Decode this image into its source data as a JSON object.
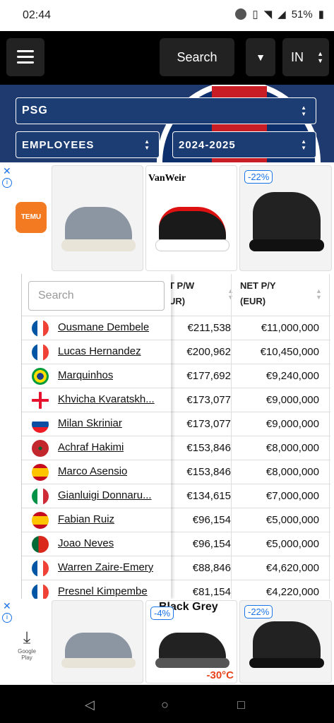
{
  "status_bar": {
    "time": "02:44",
    "battery": "51%"
  },
  "header": {
    "search_label": "Search",
    "country_label": "IN"
  },
  "filters": {
    "team": "PSG",
    "category": "EMPLOYEES",
    "season": "2024-2025"
  },
  "ads": {
    "top": {
      "brand": "TEMU",
      "items": [
        {
          "label": ""
        },
        {
          "label": "VanWeir"
        },
        {
          "label": "-22%"
        }
      ]
    },
    "bottom": {
      "store": "Google Play",
      "items": [
        {
          "label": ""
        },
        {
          "label": "Black Grey",
          "badge": "-4%",
          "sub": "-30°C"
        },
        {
          "label": "-22%"
        }
      ]
    }
  },
  "table": {
    "search_placeholder": "Search",
    "col_weekly": "T P/W",
    "col_weekly_unit": "UR)",
    "col_yearly": "NET P/Y",
    "col_yearly_unit": "(EUR)",
    "rows": [
      {
        "name": "Ousmane Dembele",
        "weekly": "€211,538",
        "yearly": "€11,000,000",
        "flag": "france"
      },
      {
        "name": "Lucas Hernandez",
        "weekly": "€200,962",
        "yearly": "€10,450,000",
        "flag": "france"
      },
      {
        "name": "Marquinhos",
        "weekly": "€177,692",
        "yearly": "€9,240,000",
        "flag": "brazil"
      },
      {
        "name": "Khvicha Kvaratskh...",
        "weekly": "€173,077",
        "yearly": "€9,000,000",
        "flag": "georgia"
      },
      {
        "name": "Milan Skriniar",
        "weekly": "€173,077",
        "yearly": "€9,000,000",
        "flag": "slovakia"
      },
      {
        "name": "Achraf Hakimi",
        "weekly": "€153,846",
        "yearly": "€8,000,000",
        "flag": "morocco"
      },
      {
        "name": "Marco Asensio",
        "weekly": "€153,846",
        "yearly": "€8,000,000",
        "flag": "spain"
      },
      {
        "name": "Gianluigi Donnaru...",
        "weekly": "€134,615",
        "yearly": "€7,000,000",
        "flag": "italy"
      },
      {
        "name": "Fabian Ruiz",
        "weekly": "€96,154",
        "yearly": "€5,000,000",
        "flag": "spain"
      },
      {
        "name": "Joao Neves",
        "weekly": "€96,154",
        "yearly": "€5,000,000",
        "flag": "portugal"
      },
      {
        "name": "Warren Zaire-Emery",
        "weekly": "€88,846",
        "yearly": "€4,620,000",
        "flag": "france"
      },
      {
        "name": "Presnel Kimpembe",
        "weekly": "€81,154",
        "yearly": "€4,220,000",
        "flag": "france"
      }
    ]
  }
}
